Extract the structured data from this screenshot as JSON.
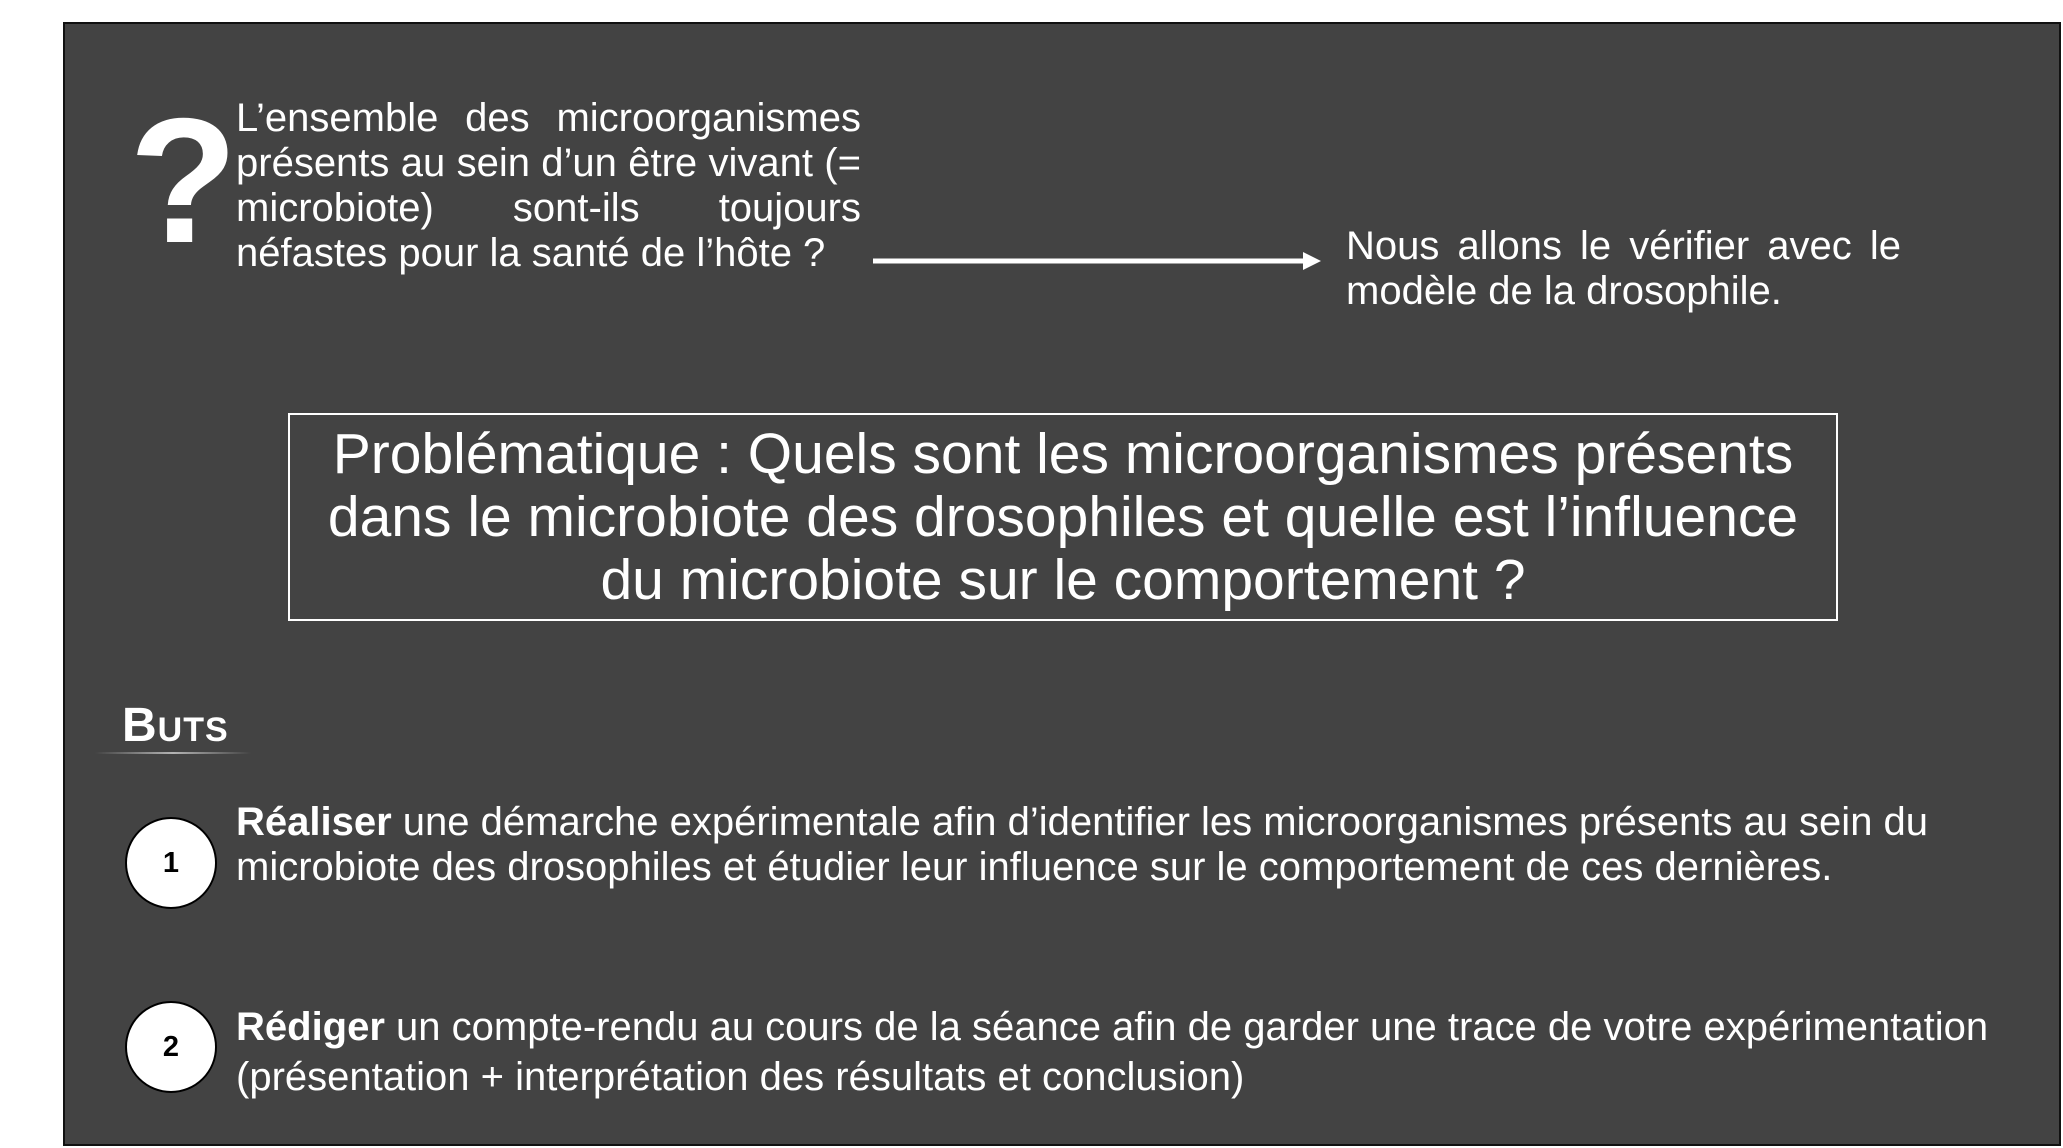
{
  "intro": {
    "question_mark": "?",
    "question": "L’ensemble des microorganismes présents au sein d’un être vivant (= microbiote) sont-ils toujours néfastes pour la santé de l’hôte ?",
    "answer": "Nous allons le vérifier avec le modèle de la drosophile."
  },
  "problem": {
    "text": "Problématique : Quels sont les microorganismes présents dans le microbiote des drosophiles et quelle est l’influence du microbiote sur le comportement ?"
  },
  "goals": {
    "title": "Buts",
    "items": [
      {
        "number": "1",
        "lead": "Réaliser",
        "text": " une démarche expérimentale afin d’identifier les microorganismes présents au sein du microbiote des drosophiles et étudier leur influence sur le comportement de ces dernières."
      },
      {
        "number": "2",
        "lead": "Rédiger",
        "text": " un compte-rendu au cours de la séance afin de garder une trace de votre expérimentation (présentation + interprétation des résultats et conclusion)"
      }
    ]
  },
  "colors": {
    "slide_background": "#434343",
    "text": "#ffffff",
    "badge_background": "#ffffff",
    "badge_text": "#000000"
  }
}
